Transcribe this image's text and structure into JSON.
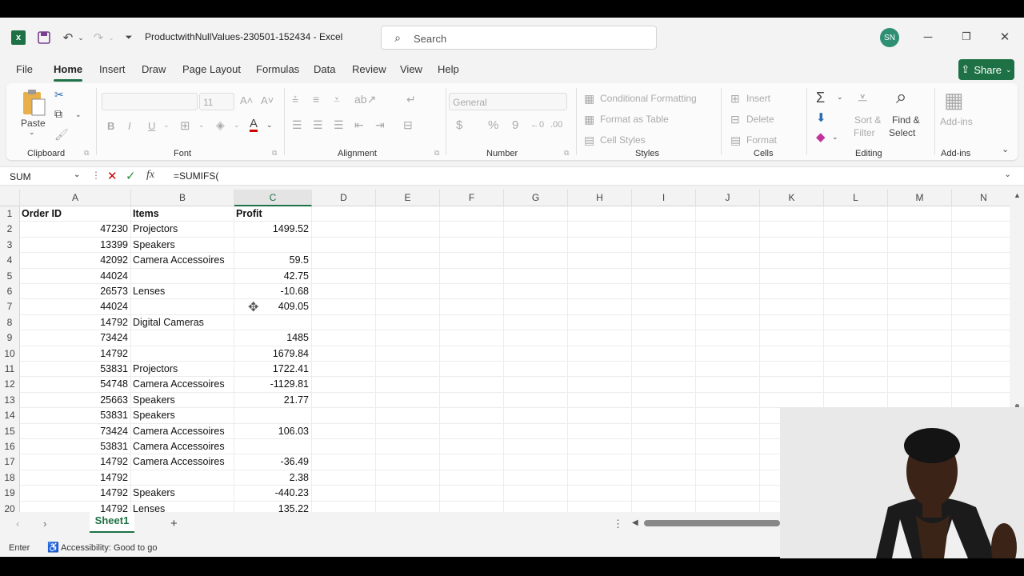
{
  "app": {
    "name": "Excel",
    "file_name": "ProductwithNullValues-230501-152434",
    "separator": "-"
  },
  "search": {
    "placeholder": "Search"
  },
  "user": {
    "initials": "SN"
  },
  "menu": {
    "tabs": [
      "File",
      "Home",
      "Insert",
      "Draw",
      "Page Layout",
      "Formulas",
      "Data",
      "Review",
      "View",
      "Help"
    ],
    "active": "Home",
    "share": "Share"
  },
  "ribbon": {
    "clipboard": {
      "paste": "Paste",
      "label": "Clipboard"
    },
    "font": {
      "size": "11",
      "label": "Font",
      "bold": "B",
      "italic": "I",
      "underline": "U"
    },
    "alignment": {
      "label": "Alignment"
    },
    "number": {
      "format": "General",
      "label": "Number",
      "currency": "$",
      "percent": "%",
      "comma": "9"
    },
    "styles": {
      "conditional": "Conditional Formatting",
      "table": "Format as Table",
      "cell": "Cell Styles",
      "label": "Styles"
    },
    "cells": {
      "insert": "Insert",
      "delete": "Delete",
      "format": "Format",
      "label": "Cells"
    },
    "editing": {
      "sort": "Sort &",
      "filter": "Filter",
      "find": "Find &",
      "select": "Select",
      "label": "Editing"
    },
    "addins": {
      "button": "Add-ins",
      "label": "Add-ins"
    }
  },
  "formula_bar": {
    "name_box": "SUM",
    "formula": "=SUMIFS("
  },
  "columns": [
    "A",
    "B",
    "C",
    "D",
    "E",
    "F",
    "G",
    "H",
    "I",
    "J",
    "K",
    "L",
    "M",
    "N"
  ],
  "selected_column": "C",
  "rows": [
    {
      "n": "1",
      "a": "Order ID",
      "b": "Items",
      "c": "Profit"
    },
    {
      "n": "2",
      "a": "47230",
      "b": "Projectors",
      "c": "1499.52"
    },
    {
      "n": "3",
      "a": "13399",
      "b": "Speakers",
      "c": ""
    },
    {
      "n": "4",
      "a": "42092",
      "b": "Camera Accessoires",
      "c": "59.5"
    },
    {
      "n": "5",
      "a": "44024",
      "b": "",
      "c": "42.75"
    },
    {
      "n": "6",
      "a": "26573",
      "b": "Lenses",
      "c": "-10.68"
    },
    {
      "n": "7",
      "a": "44024",
      "b": "",
      "c": "409.05"
    },
    {
      "n": "8",
      "a": "14792",
      "b": "Digital Cameras",
      "c": ""
    },
    {
      "n": "9",
      "a": "73424",
      "b": "",
      "c": "1485"
    },
    {
      "n": "10",
      "a": "14792",
      "b": "",
      "c": "1679.84"
    },
    {
      "n": "11",
      "a": "53831",
      "b": "Projectors",
      "c": "1722.41"
    },
    {
      "n": "12",
      "a": "54748",
      "b": "Camera Accessoires",
      "c": "-1129.81"
    },
    {
      "n": "13",
      "a": "25663",
      "b": "Speakers",
      "c": "21.77"
    },
    {
      "n": "14",
      "a": "53831",
      "b": "Speakers",
      "c": ""
    },
    {
      "n": "15",
      "a": "73424",
      "b": "Camera Accessoires",
      "c": "106.03"
    },
    {
      "n": "16",
      "a": "53831",
      "b": "Camera Accessoires",
      "c": ""
    },
    {
      "n": "17",
      "a": "14792",
      "b": "Camera Accessoires",
      "c": "-36.49"
    },
    {
      "n": "18",
      "a": "14792",
      "b": "",
      "c": "2.38"
    },
    {
      "n": "19",
      "a": "14792",
      "b": "Speakers",
      "c": "-440.23"
    },
    {
      "n": "20",
      "a": "14792",
      "b": "Lenses",
      "c": "135.22"
    }
  ],
  "sheets": {
    "active": "Sheet1",
    "add": "+"
  },
  "status": {
    "mode": "Enter",
    "accessibility": "Accessibility: Good to go"
  }
}
